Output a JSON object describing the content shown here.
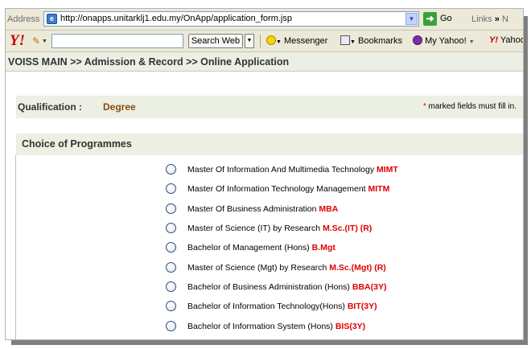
{
  "browser": {
    "address_label": "Address",
    "url": "http://onapps.unitarklj1.edu.my/OnApp/application_form.jsp",
    "go_label": "Go",
    "links_label": "Links",
    "links_overflow": "»",
    "links_clip": "N"
  },
  "toolbar": {
    "search_web_label": "Search Web",
    "messenger_label": "Messenger",
    "bookmarks_label": "Bookmarks",
    "my_yahoo_label": "My Yahoo!",
    "yahoo_label": "Yahoo"
  },
  "page": {
    "breadcrumb": "VOISS MAIN >> Admission & Record >> Online Application",
    "qualification_label": "Qualification :",
    "qualification_value": "Degree",
    "required_star": "*",
    "required_note": " marked fields must fill in.",
    "choice_heading": "Choice of Programmes",
    "programmes": [
      {
        "name": "Master Of Information And Multimedia Technology",
        "code": "MIMT"
      },
      {
        "name": "Master Of Information Technology Management",
        "code": "MITM"
      },
      {
        "name": "Master Of Business Administration",
        "code": "MBA"
      },
      {
        "name": "Master of Science (IT) by Research",
        "code": "M.Sc.(IT) (R)"
      },
      {
        "name": "Bachelor of Management (Hons)",
        "code": "B.Mgt"
      },
      {
        "name": "Master of Science (Mgt) by Research",
        "code": "M.Sc.(Mgt) (R)"
      },
      {
        "name": "Bachelor of Business Administration (Hons)",
        "code": "BBA(3Y)"
      },
      {
        "name": "Bachelor of Information Technology(Hons)",
        "code": "BIT(3Y)"
      },
      {
        "name": "Bachelor of Information System (Hons)",
        "code": "BIS(3Y)"
      }
    ]
  },
  "colors": {
    "code_red": "#e00000",
    "qualification_brown": "#8a4b12",
    "header_band": "#ecefe3"
  }
}
